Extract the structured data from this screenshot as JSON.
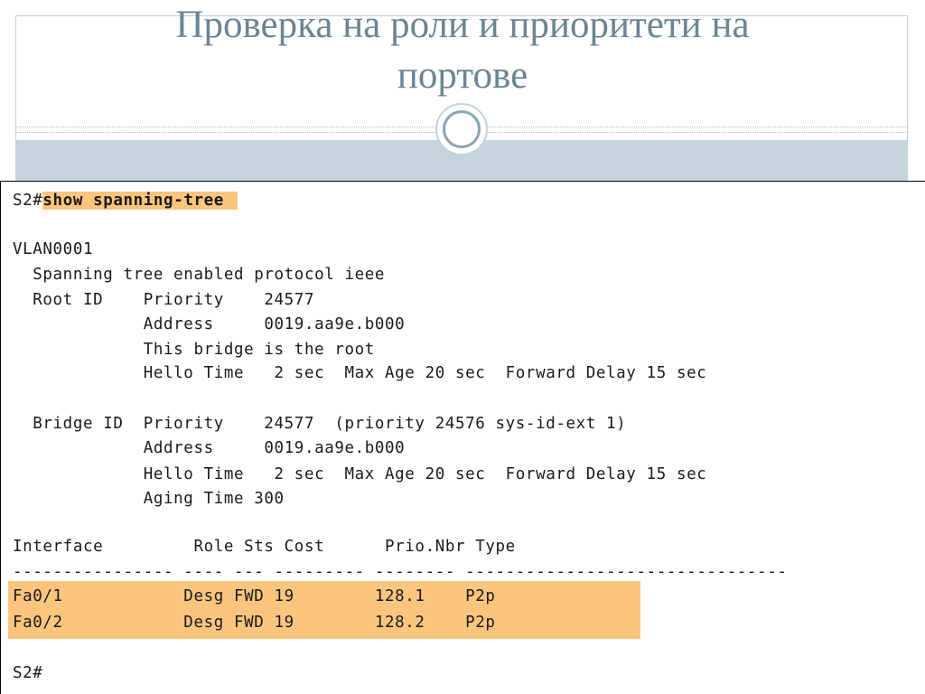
{
  "slide": {
    "title": "Проверка на роли и приоритети на\nпортове"
  },
  "terminal": {
    "prompt": "S2#",
    "command": "show spanning-tree ",
    "vlan": "VLAN0001",
    "protocol_line": "  Spanning tree enabled protocol ieee",
    "root_priority": "  Root ID    Priority    24577",
    "root_address": "             Address     0019.aa9e.b000",
    "root_note": "             This bridge is the root",
    "root_timers": "             Hello Time   2 sec  Max Age 20 sec  Forward Delay 15 sec",
    "bridge_priority": "  Bridge ID  Priority    24577  (priority 24576 sys-id-ext 1)",
    "bridge_address": "             Address     0019.aa9e.b000",
    "bridge_timers": "             Hello Time   2 sec  Max Age 20 sec  Forward Delay 15 sec",
    "bridge_aging": "             Aging Time 300",
    "table_header": "Interface         Role Sts Cost      Prio.Nbr Type",
    "table_separator": "---------------- ---- --- --------- -------- --------------------------------",
    "rows": [
      "Fa0/1            Desg FWD 19        128.1    P2p",
      "Fa0/2            Desg FWD 19        128.2    P2p"
    ],
    "final_prompt": "S2#"
  }
}
